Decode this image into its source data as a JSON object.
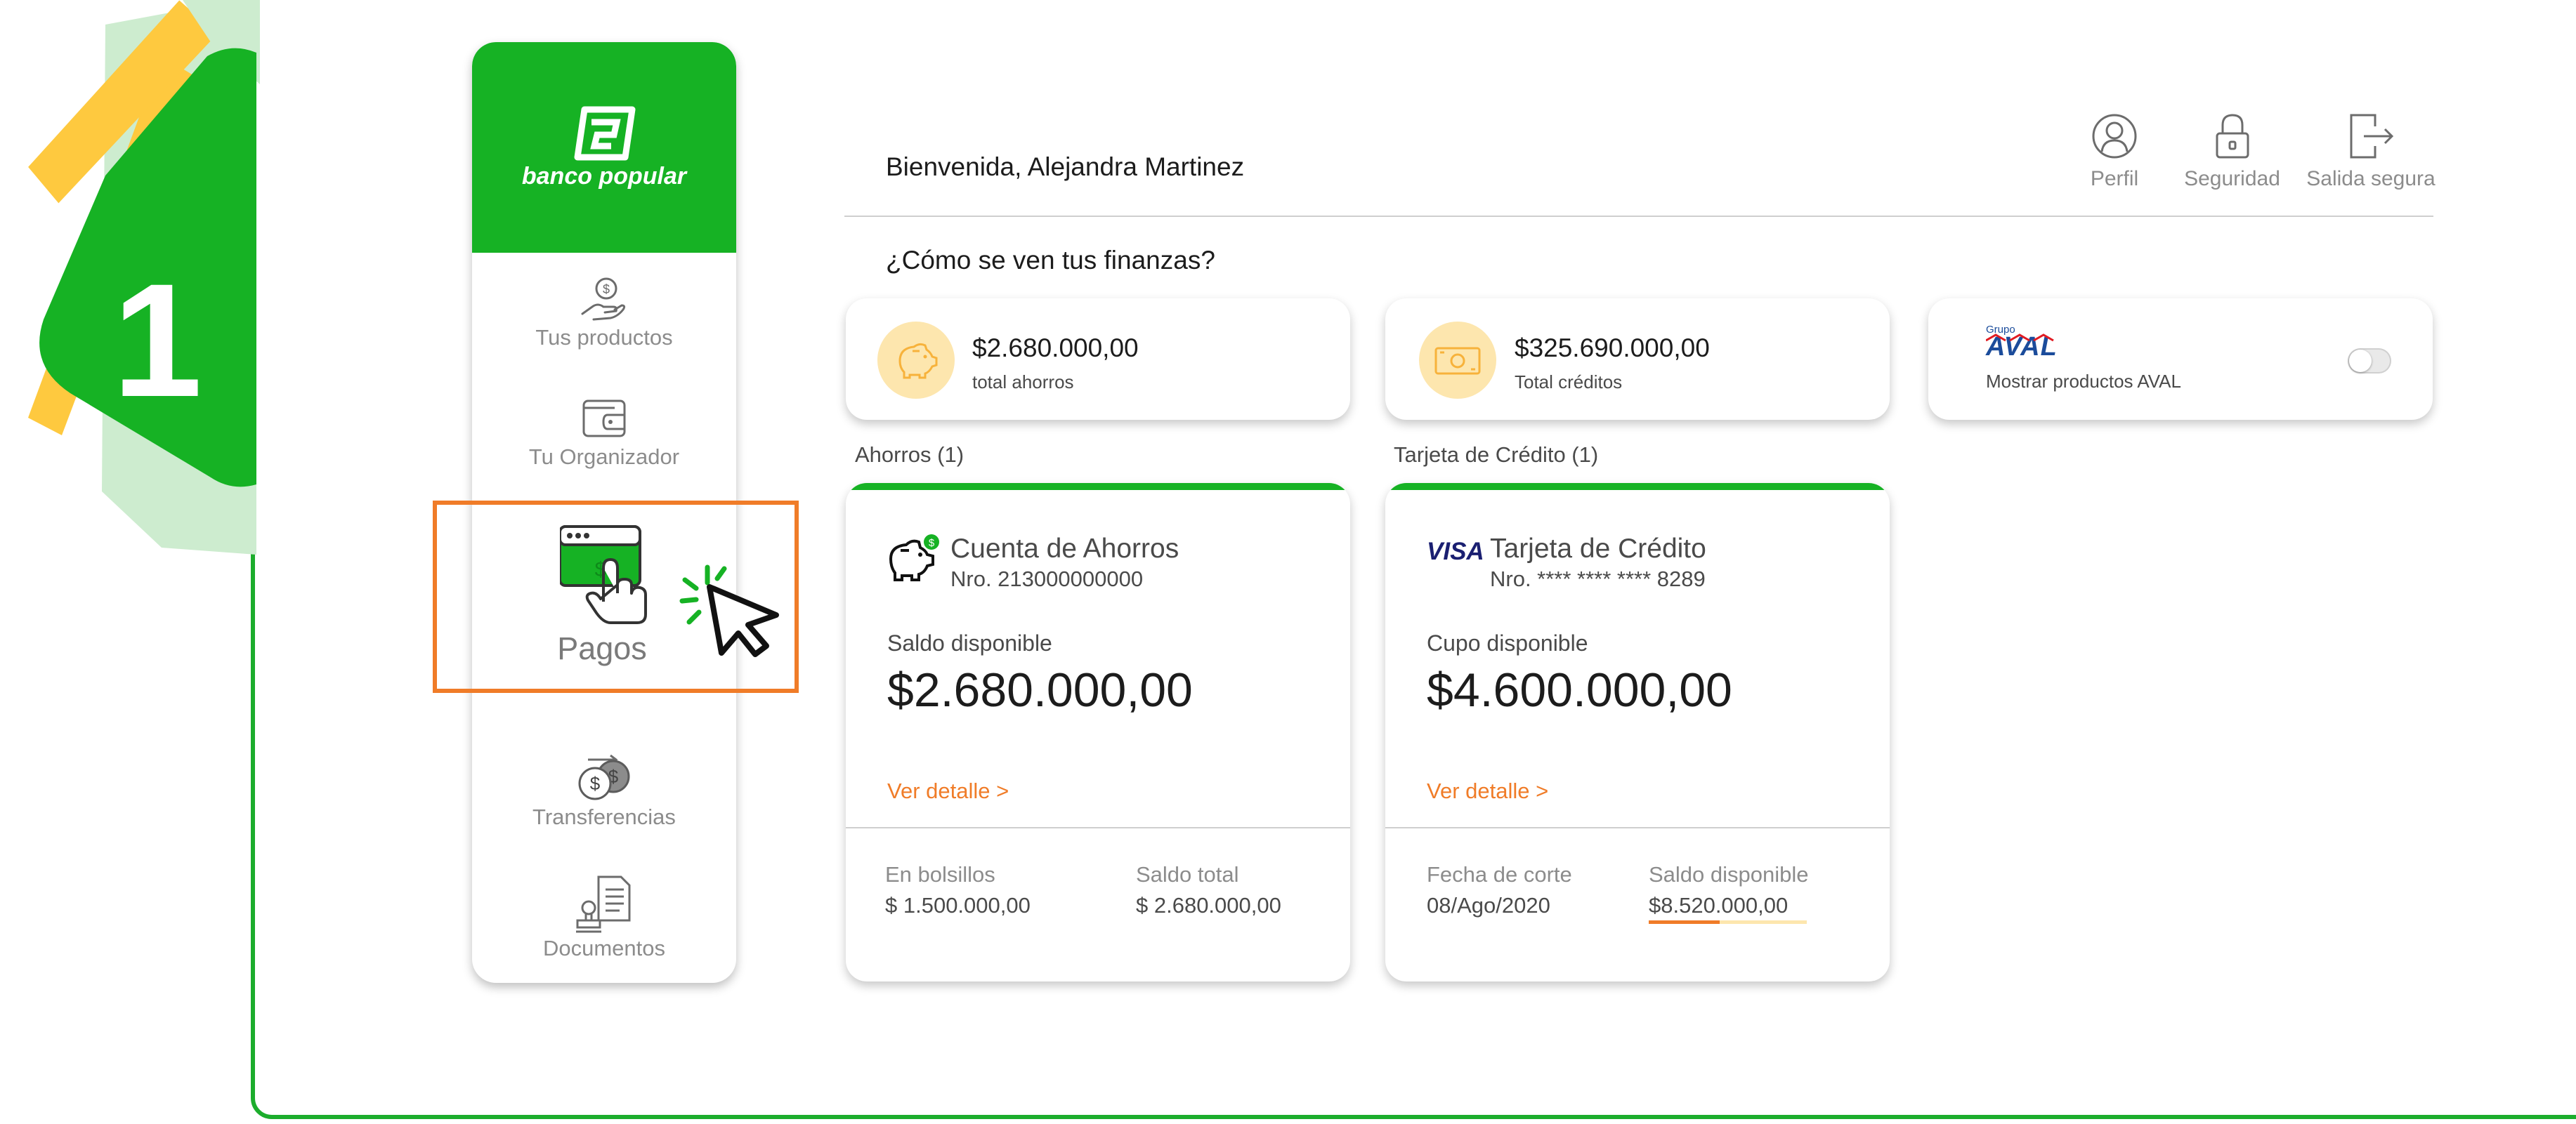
{
  "step": {
    "number": "1"
  },
  "colors": {
    "brand_green": "#16b224",
    "accent_orange": "#f07c28",
    "highlight_yellow": "#fec93f"
  },
  "logo": {
    "text": "banco popular"
  },
  "sidebar": {
    "items": [
      {
        "label": "Tus productos",
        "icon": "hand-coin-icon"
      },
      {
        "label": "Tu Organizador",
        "icon": "wallet-icon"
      },
      {
        "label": "Pagos",
        "icon": "payment-tap-icon",
        "active": true
      },
      {
        "label": "Transferencias",
        "icon": "coins-exchange-icon"
      },
      {
        "label": "Documentos",
        "icon": "documents-stamp-icon"
      }
    ]
  },
  "header": {
    "welcome": "Bienvenida, Alejandra Martinez",
    "actions": [
      {
        "label": "Perfil",
        "icon": "user-icon"
      },
      {
        "label": "Seguridad",
        "icon": "lock-icon"
      },
      {
        "label": "Salida segura",
        "icon": "logout-icon"
      }
    ]
  },
  "finances": {
    "question": "¿Cómo se ven tus finanzas?",
    "summary": [
      {
        "amount": "$2.680.000,00",
        "label": "total ahorros",
        "icon": "piggy-bank-icon"
      },
      {
        "amount": "$325.690.000,00",
        "label": "Total créditos",
        "icon": "banknote-icon"
      }
    ],
    "aval": {
      "group_text": "Grupo",
      "brand_text": "AVAL",
      "label": "Mostrar productos AVAL",
      "toggle_on": false
    }
  },
  "sections": {
    "savings": {
      "title": "Ahorros (1)",
      "card": {
        "name": "Cuenta de Ahorros",
        "number": "Nro. 213000000000",
        "available_label": "Saldo disponible",
        "available_amount": "$2.680.000,00",
        "detail_link": "Ver detalle >",
        "footer": [
          {
            "label": "En bolsillos",
            "value": "$ 1.500.000,00"
          },
          {
            "label": "Saldo total",
            "value": "$ 2.680.000,00"
          }
        ]
      }
    },
    "credit": {
      "title": "Tarjeta de Crédito (1)",
      "card": {
        "brand": "VISA",
        "name": "Tarjeta de Crédito",
        "number": "Nro. **** **** **** 8289",
        "available_label": "Cupo disponible",
        "available_amount": "$4.600.000,00",
        "detail_link": "Ver detalle >",
        "footer": [
          {
            "label": "Fecha de corte",
            "value": "08/Ago/2020"
          },
          {
            "label": "Saldo disponible",
            "value": "$8.520.000,00",
            "usage_fraction": 0.45
          }
        ]
      }
    }
  }
}
